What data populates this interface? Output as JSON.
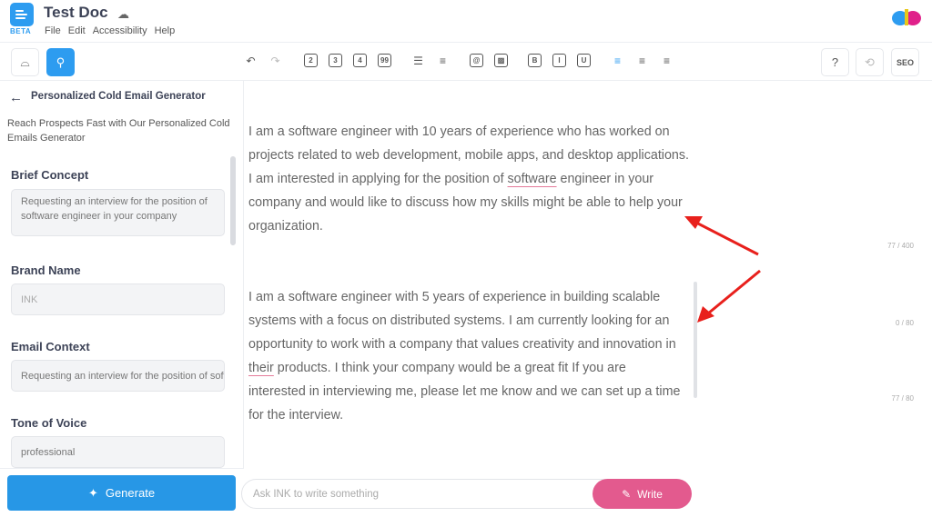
{
  "app": {
    "badge": "BETA",
    "title": "Test Doc",
    "menu": [
      "File",
      "Edit",
      "Accessibility",
      "Help"
    ]
  },
  "toolbar": {
    "heading_buttons": [
      "2",
      "3",
      "4",
      "99"
    ],
    "format_buttons": [
      "B",
      "I",
      "U"
    ],
    "seo_label": "SEO",
    "active_tool_color": "#2d9cf0"
  },
  "sidebar": {
    "title": "Personalized Cold Email Generator",
    "description": "Reach Prospects Fast with Our Personalized Cold Emails Generator",
    "fields": [
      {
        "label": "Brief Concept",
        "value": "Requesting an interview for the position of software engineer in your company",
        "count": "77 / 400"
      },
      {
        "label": "Brand Name",
        "placeholder": "INK",
        "count": "0 / 80"
      },
      {
        "label": "Email Context",
        "value": "Requesting an interview for the position of software engineer in your company",
        "count": "77 / 80"
      },
      {
        "label": "Tone of Voice",
        "value": "professional"
      }
    ],
    "generate_label": "Generate"
  },
  "editor": {
    "paragraphs": [
      {
        "before": "I am a software engineer with 10 years of experience who has worked on projects related to web development, mobile apps, and desktop applications. I am interested in applying for the position of ",
        "underlined": "software",
        "after": " engineer in your company and would like to discuss how my skills might be able to help your organization."
      },
      {
        "before": "I am a software engineer with 5 years of experience in building scalable systems with a focus on distributed systems. I am currently looking for an opportunity to work with a company that values creativity and innovation in ",
        "underlined": "their",
        "after": " products. I think your company would be a great fit If you are interested in interviewing me, please let me know and we can set up a time for the interview."
      }
    ]
  },
  "ask": {
    "placeholder": "Ask INK to write something",
    "write_label": "Write",
    "write_color": "#e35a8e"
  },
  "annotation_color": "#e8201c"
}
